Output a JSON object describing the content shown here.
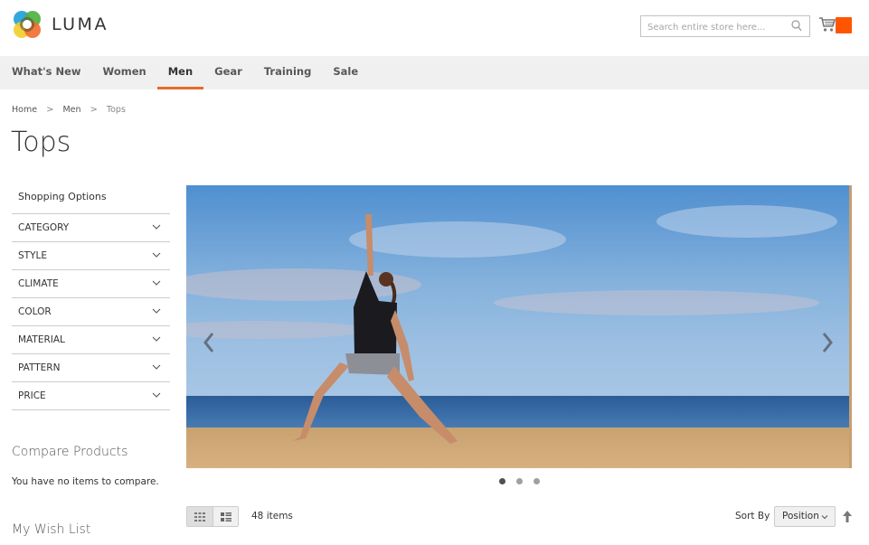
{
  "header": {
    "logo_text": "LUMA",
    "search_placeholder": "Search entire store here...",
    "cart_label": "cart"
  },
  "nav": {
    "items": [
      {
        "label": "What's New",
        "active": false
      },
      {
        "label": "Women",
        "active": false
      },
      {
        "label": "Men",
        "active": true
      },
      {
        "label": "Gear",
        "active": false
      },
      {
        "label": "Training",
        "active": false
      },
      {
        "label": "Sale",
        "active": false
      }
    ]
  },
  "breadcrumb": {
    "items": [
      "Home",
      "Men",
      "Tops"
    ],
    "separator": ">"
  },
  "page": {
    "title": "Tops"
  },
  "sidebar": {
    "title": "Shopping Options",
    "filters": [
      "CATEGORY",
      "STYLE",
      "CLIMATE",
      "COLOR",
      "MATERIAL",
      "PATTERN",
      "PRICE"
    ],
    "compare_title": "Compare Products",
    "compare_empty": "You have no items to compare.",
    "wishlist_title": "My Wish List"
  },
  "banner": {
    "slides": 3,
    "active_slide": 1,
    "description": "Woman in yoga warrior pose on a beach"
  },
  "toolbar": {
    "view_modes": [
      "grid",
      "list"
    ],
    "active_mode": "grid",
    "items_count": "48 items",
    "sort_label": "Sort By",
    "sort_value": "Position"
  },
  "colors": {
    "accent": "#ff5501",
    "nav_active_underline": "#e76a2b",
    "nav_bg": "#f0f0f0"
  }
}
